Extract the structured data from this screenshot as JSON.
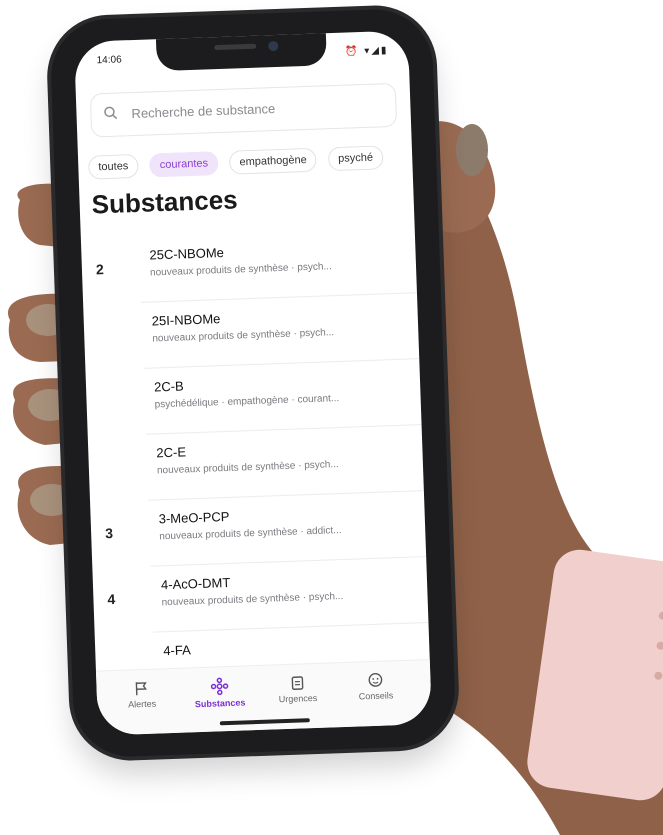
{
  "status_bar": {
    "time": "14:06",
    "icons": "⏰ ▾◢▮"
  },
  "search": {
    "placeholder": "Recherche de substance"
  },
  "filters": [
    "toutes",
    "courantes",
    "empathogène",
    "psyché"
  ],
  "active_filter": "courantes",
  "page_title": "Substances",
  "substances": [
    {
      "letter": "2",
      "name": "25C-NBOMe",
      "desc": "nouveaux produits de synthèse · psych..."
    },
    {
      "letter": "",
      "name": "25I-NBOMe",
      "desc": "nouveaux produits de synthèse · psych..."
    },
    {
      "letter": "",
      "name": "2C-B",
      "desc": "psychédélique · empathogène · courant..."
    },
    {
      "letter": "",
      "name": "2C-E",
      "desc": "nouveaux produits de synthèse · psych..."
    },
    {
      "letter": "3",
      "name": "3-MeO-PCP",
      "desc": "nouveaux produits de synthèse · addict..."
    },
    {
      "letter": "4",
      "name": "4-AcO-DMT",
      "desc": "nouveaux produits de synthèse · psych..."
    },
    {
      "letter": "",
      "name": "4-FA",
      "desc": ""
    }
  ],
  "bottom_nav": [
    {
      "label": "Alertes",
      "icon": "flag-icon",
      "active": false
    },
    {
      "label": "Substances",
      "icon": "molecule-icon",
      "active": true
    },
    {
      "label": "Urgences",
      "icon": "clipboard-icon",
      "active": false
    },
    {
      "label": "Conseils",
      "icon": "face-icon",
      "active": false
    }
  ],
  "colors": {
    "accent": "#7b2fd6",
    "chip_active_bg": "#f0e4fb",
    "skin": "#9a6b52",
    "strap": "#f1cfcc"
  }
}
